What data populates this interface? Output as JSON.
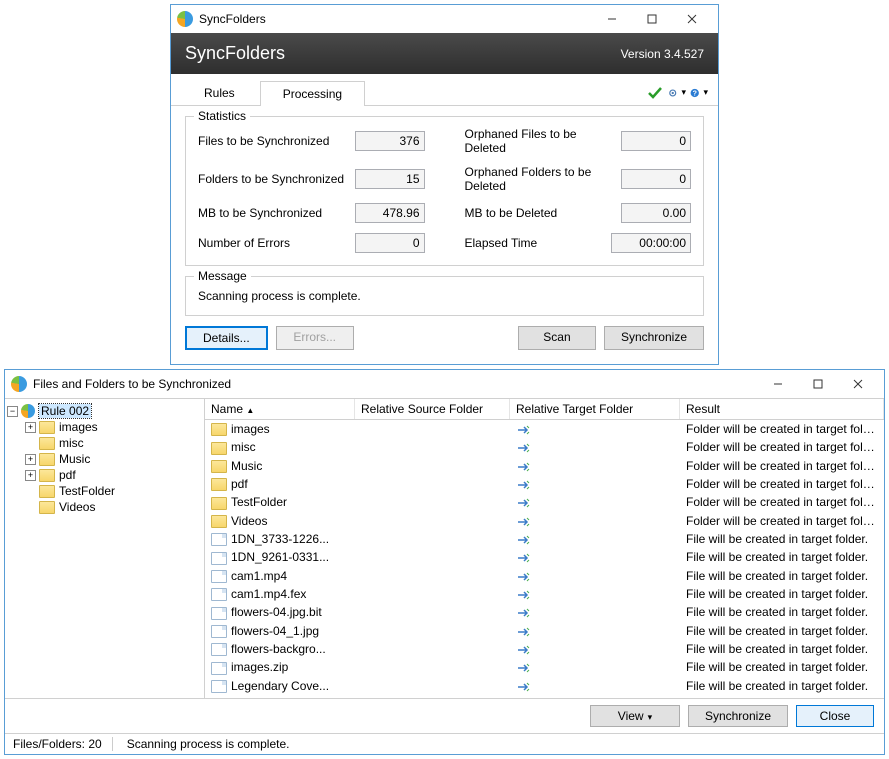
{
  "win1": {
    "title": "SyncFolders",
    "banner": {
      "title": "SyncFolders",
      "version": "Version 3.4.527"
    },
    "tabs": {
      "rules": "Rules",
      "processing": "Processing"
    },
    "stats": {
      "legend": "Statistics",
      "files_sync_label": "Files to be Synchronized",
      "files_sync": "376",
      "folders_sync_label": "Folders to be Synchronized",
      "folders_sync": "15",
      "mb_sync_label": "MB to be Synchronized",
      "mb_sync": "478.96",
      "errors_label": "Number of Errors",
      "errors": "0",
      "orph_files_label": "Orphaned Files to be Deleted",
      "orph_files": "0",
      "orph_folders_label": "Orphaned Folders to be Deleted",
      "orph_folders": "0",
      "mb_del_label": "MB to be Deleted",
      "mb_del": "0.00",
      "elapsed_label": "Elapsed Time",
      "elapsed": "00:00:00"
    },
    "message": {
      "legend": "Message",
      "text": "Scanning process is complete."
    },
    "buttons": {
      "details": "Details...",
      "errors": "Errors...",
      "scan": "Scan",
      "sync": "Synchronize"
    }
  },
  "win2": {
    "title": "Files and Folders to be Synchronized",
    "tree": {
      "root": "Rule 002",
      "children": [
        "images",
        "misc",
        "Music",
        "pdf",
        "TestFolder",
        "Videos"
      ]
    },
    "cols": {
      "name": "Name",
      "src": "Relative Source Folder",
      "tgt": "Relative Target Folder",
      "res": "Result"
    },
    "rows": [
      {
        "name": "images",
        "type": "folder",
        "res": "Folder will be created in target folder."
      },
      {
        "name": "misc",
        "type": "folder",
        "res": "Folder will be created in target folder."
      },
      {
        "name": "Music",
        "type": "folder",
        "res": "Folder will be created in target folder."
      },
      {
        "name": "pdf",
        "type": "folder",
        "res": "Folder will be created in target folder."
      },
      {
        "name": "TestFolder",
        "type": "folder",
        "res": "Folder will be created in target folder."
      },
      {
        "name": "Videos",
        "type": "folder",
        "res": "Folder will be created in target folder."
      },
      {
        "name": "1DN_3733-1226...",
        "type": "file",
        "res": "File will be created in target folder."
      },
      {
        "name": "1DN_9261-0331...",
        "type": "file",
        "res": "File will be created in target folder."
      },
      {
        "name": "cam1.mp4",
        "type": "file",
        "res": "File will be created in target folder."
      },
      {
        "name": "cam1.mp4.fex",
        "type": "file",
        "res": "File will be created in target folder."
      },
      {
        "name": "flowers-04.jpg.bit",
        "type": "file",
        "res": "File will be created in target folder."
      },
      {
        "name": "flowers-04_1.jpg",
        "type": "file",
        "res": "File will be created in target folder."
      },
      {
        "name": "flowers-backgro...",
        "type": "file",
        "res": "File will be created in target folder."
      },
      {
        "name": "images.zip",
        "type": "file",
        "res": "File will be created in target folder."
      },
      {
        "name": "Legendary Cove...",
        "type": "file",
        "res": "File will be created in target folder."
      }
    ],
    "buttons": {
      "view": "View",
      "sync": "Synchronize",
      "close": "Close"
    },
    "status": {
      "count": "Files/Folders: 20",
      "msg": "Scanning process is complete."
    }
  }
}
